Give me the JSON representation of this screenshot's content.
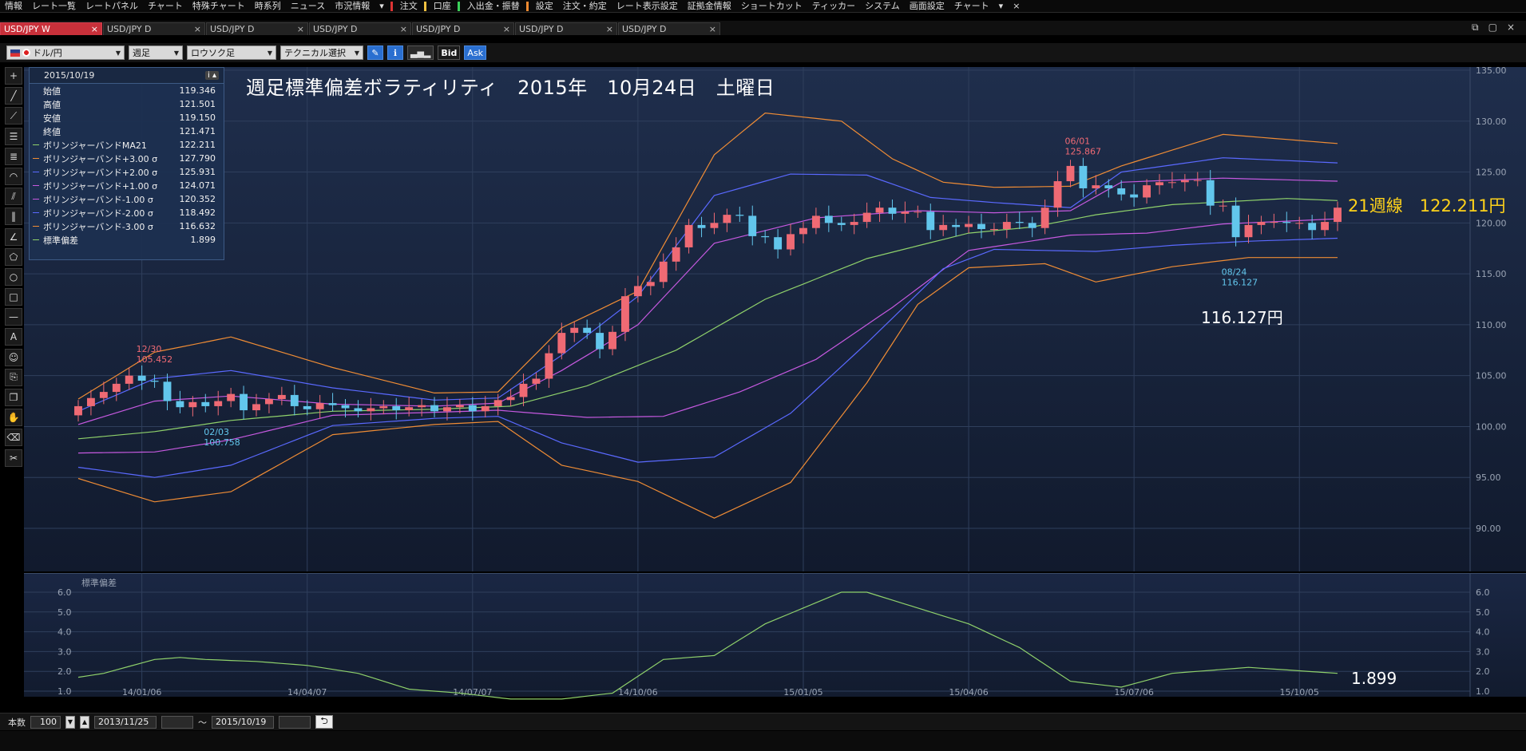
{
  "menu": {
    "items": [
      "情報",
      "レート一覧",
      "レートパネル",
      "チャート",
      "特殊チャート",
      "時系列",
      "ニュース",
      "市況情報",
      "▾",
      "注文",
      "口座",
      "入出金・振替",
      "設定",
      "注文・約定",
      "レート表示設定",
      "証拠金情報",
      "ショートカット",
      "ティッカー",
      "システム",
      "画面設定",
      "チャート",
      "▾",
      "×"
    ]
  },
  "tabs": [
    {
      "label": "USD/JPY W",
      "close": "×"
    },
    {
      "label": "USD/JPY D",
      "close": "×"
    },
    {
      "label": "USD/JPY D",
      "close": "×"
    },
    {
      "label": "USD/JPY D",
      "close": "×"
    },
    {
      "label": "USD/JPY D",
      "close": "×"
    },
    {
      "label": "USD/JPY D",
      "close": "×"
    },
    {
      "label": "USD/JPY D",
      "close": "×"
    }
  ],
  "window_controls": {
    "restore": "⧉",
    "maximize": "▢",
    "close": "×"
  },
  "toolbar": {
    "pair": "ドル/円",
    "period": "週足",
    "chart_type": "ロウソク足",
    "technical": "テクニカル選択",
    "bid": "Bid",
    "ask": "Ask"
  },
  "info_panel": {
    "date": "2015/10/19",
    "button": "i ▴",
    "rows": [
      {
        "label": "始値",
        "value": "119.346",
        "color": ""
      },
      {
        "label": "高値",
        "value": "121.501",
        "color": ""
      },
      {
        "label": "安値",
        "value": "119.150",
        "color": ""
      },
      {
        "label": "終値",
        "value": "121.471",
        "color": ""
      },
      {
        "label": "ボリンジャーバンドMA21",
        "value": "122.211",
        "color": "#8fd16b"
      },
      {
        "label": "ボリンジャーバンド+3.00 σ",
        "value": "127.790",
        "color": "#ef8c35"
      },
      {
        "label": "ボリンジャーバンド+2.00 σ",
        "value": "125.931",
        "color": "#5a69ff"
      },
      {
        "label": "ボリンジャーバンド+1.00 σ",
        "value": "124.071",
        "color": "#c659e0"
      },
      {
        "label": "ボリンジャーバンド-1.00 σ",
        "value": "120.352",
        "color": "#c659e0"
      },
      {
        "label": "ボリンジャーバンド-2.00 σ",
        "value": "118.492",
        "color": "#5a69ff"
      },
      {
        "label": "ボリンジャーバンド-3.00 σ",
        "value": "116.632",
        "color": "#ef8c35"
      },
      {
        "label": "標準偏差",
        "value": "1.899",
        "color": "#8fd16b"
      }
    ]
  },
  "title": "週足標準偏差ボラティリティ　2015年　10月24日　土曜日",
  "annotations": {
    "ma_label": "21週線　122.211円",
    "low_price": "116.127円",
    "sd_value": "1.899"
  },
  "subchart_label": "標準偏差",
  "bottom": {
    "count_label": "本数",
    "count": "100",
    "from": "2013/11/25",
    "tilde": "～",
    "to": "2015/10/19",
    "icon": "⮌"
  },
  "chart_data": [
    {
      "type": "candlestick",
      "series_name": "USD/JPY 週足",
      "ylim": [
        90,
        135
      ],
      "y_ticks": [
        "135.00",
        "130.00",
        "125.00",
        "120.00",
        "115.00",
        "110.00",
        "105.00",
        "100.00",
        "95.00",
        "90.00"
      ],
      "x_ticks": [
        "14/01/06",
        "14/04/07",
        "14/07/07",
        "14/10/06",
        "15/01/05",
        "15/04/06",
        "15/07/06",
        "15/10/05"
      ],
      "grid": true,
      "candles_start": "2013/11/25",
      "close": [
        102.0,
        102.8,
        103.4,
        104.2,
        105.0,
        104.5,
        104.4,
        102.5,
        101.9,
        102.4,
        102.0,
        102.5,
        103.2,
        101.6,
        102.2,
        102.7,
        103.1,
        102.0,
        101.7,
        102.3,
        102.1,
        101.8,
        101.5,
        101.8,
        102.0,
        101.6,
        101.9,
        102.1,
        101.5,
        101.9,
        102.1,
        101.5,
        102.0,
        102.6,
        102.9,
        104.2,
        104.7,
        107.2,
        109.2,
        109.7,
        109.2,
        107.6,
        109.3,
        112.8,
        113.8,
        114.2,
        116.2,
        117.6,
        119.8,
        119.5,
        120.0,
        120.8,
        120.7,
        118.7,
        118.6,
        117.4,
        118.9,
        119.5,
        120.7,
        120.0,
        119.8,
        120.1,
        121.0,
        121.5,
        120.9,
        121.1,
        121.1,
        119.3,
        119.8,
        119.6,
        119.9,
        119.4,
        119.4,
        120.1,
        120.0,
        119.5,
        121.5,
        124.1,
        125.6,
        123.4,
        123.7,
        123.4,
        122.8,
        122.5,
        123.7,
        124.0,
        124.0,
        124.2,
        124.2,
        121.7,
        121.7,
        118.6,
        119.8,
        120.1,
        120.1,
        120.0,
        120.0,
        119.3,
        120.1,
        121.5
      ],
      "annotations": [
        {
          "label": "12/30",
          "value": "105.452"
        },
        {
          "label": "02/03",
          "value": "100.758"
        },
        {
          "label": "06/01",
          "value": "125.867"
        },
        {
          "label": "08/24",
          "value": "116.127"
        }
      ],
      "bands": [
        {
          "name": "MA21",
          "color": "#8fd16b",
          "keys": [
            [
              0,
              98.8
            ],
            [
              6,
              99.5
            ],
            [
              12,
              100.6
            ],
            [
              20,
              101.5
            ],
            [
              28,
              101.7
            ],
            [
              34,
              102.0
            ],
            [
              40,
              104.0
            ],
            [
              47,
              107.5
            ],
            [
              54,
              112.5
            ],
            [
              62,
              116.5
            ],
            [
              70,
              119.0
            ],
            [
              75,
              119.6
            ],
            [
              80,
              120.8
            ],
            [
              86,
              121.8
            ],
            [
              95,
              122.4
            ],
            [
              99,
              122.2
            ]
          ]
        },
        {
          "name": "+1σ",
          "color": "#c659e0",
          "keys": [
            [
              0,
              100.2
            ],
            [
              6,
              102.5
            ],
            [
              12,
              103.0
            ],
            [
              20,
              102.2
            ],
            [
              28,
              102.0
            ],
            [
              33,
              102.3
            ],
            [
              38,
              105.5
            ],
            [
              44,
              110.0
            ],
            [
              50,
              118.0
            ],
            [
              58,
              120.5
            ],
            [
              66,
              121.2
            ],
            [
              72,
              121.0
            ],
            [
              78,
              121.2
            ],
            [
              82,
              124.0
            ],
            [
              90,
              124.4
            ],
            [
              99,
              124.1
            ]
          ]
        },
        {
          "name": "+2σ",
          "color": "#5a69ff",
          "keys": [
            [
              0,
              101.5
            ],
            [
              6,
              104.7
            ],
            [
              12,
              105.5
            ],
            [
              20,
              103.8
            ],
            [
              28,
              102.6
            ],
            [
              33,
              102.8
            ],
            [
              38,
              107.0
            ],
            [
              44,
              112.8
            ],
            [
              50,
              122.7
            ],
            [
              56,
              124.8
            ],
            [
              62,
              124.7
            ],
            [
              67,
              122.5
            ],
            [
              72,
              122.0
            ],
            [
              78,
              121.5
            ],
            [
              82,
              125.0
            ],
            [
              90,
              126.4
            ],
            [
              99,
              125.9
            ]
          ]
        },
        {
          "name": "+3σ",
          "color": "#ef8c35",
          "keys": [
            [
              0,
              102.7
            ],
            [
              6,
              107.3
            ],
            [
              12,
              108.8
            ],
            [
              20,
              105.8
            ],
            [
              28,
              103.3
            ],
            [
              33,
              103.4
            ],
            [
              38,
              109.7
            ],
            [
              44,
              113.3
            ],
            [
              50,
              126.7
            ],
            [
              54,
              130.8
            ],
            [
              60,
              130.0
            ],
            [
              64,
              126.3
            ],
            [
              68,
              124.0
            ],
            [
              72,
              123.5
            ],
            [
              78,
              123.6
            ],
            [
              82,
              125.6
            ],
            [
              90,
              128.7
            ],
            [
              99,
              127.8
            ]
          ]
        },
        {
          "name": "-1σ",
          "color": "#c659e0",
          "keys": [
            [
              0,
              97.4
            ],
            [
              6,
              97.5
            ],
            [
              12,
              98.7
            ],
            [
              20,
              101.1
            ],
            [
              28,
              101.4
            ],
            [
              33,
              101.6
            ],
            [
              40,
              100.9
            ],
            [
              46,
              101.0
            ],
            [
              52,
              103.4
            ],
            [
              58,
              106.6
            ],
            [
              64,
              111.7
            ],
            [
              70,
              117.3
            ],
            [
              78,
              118.8
            ],
            [
              84,
              119.0
            ],
            [
              90,
              119.9
            ],
            [
              99,
              120.4
            ]
          ]
        },
        {
          "name": "-2σ",
          "color": "#5a69ff",
          "keys": [
            [
              0,
              96.0
            ],
            [
              6,
              95.0
            ],
            [
              12,
              96.2
            ],
            [
              20,
              100.1
            ],
            [
              28,
              100.8
            ],
            [
              33,
              101.0
            ],
            [
              38,
              98.4
            ],
            [
              44,
              96.5
            ],
            [
              50,
              97.0
            ],
            [
              56,
              101.3
            ],
            [
              62,
              108.2
            ],
            [
              68,
              115.5
            ],
            [
              72,
              117.4
            ],
            [
              80,
              117.2
            ],
            [
              86,
              117.8
            ],
            [
              92,
              118.2
            ],
            [
              99,
              118.5
            ]
          ]
        },
        {
          "name": "-3σ",
          "color": "#ef8c35",
          "keys": [
            [
              0,
              94.9
            ],
            [
              6,
              92.6
            ],
            [
              12,
              93.6
            ],
            [
              20,
              99.2
            ],
            [
              28,
              100.2
            ],
            [
              33,
              100.5
            ],
            [
              38,
              96.2
            ],
            [
              44,
              94.6
            ],
            [
              50,
              91.0
            ],
            [
              56,
              94.5
            ],
            [
              62,
              104.3
            ],
            [
              66,
              112.0
            ],
            [
              70,
              115.6
            ],
            [
              76,
              116.0
            ],
            [
              80,
              114.2
            ],
            [
              86,
              115.7
            ],
            [
              92,
              116.6
            ],
            [
              99,
              116.6
            ]
          ]
        }
      ]
    },
    {
      "type": "line",
      "series": [
        {
          "name": "標準偏差",
          "color": "#8fd16b",
          "keys": [
            [
              0,
              1.7
            ],
            [
              2,
              1.9
            ],
            [
              6,
              2.6
            ],
            [
              8,
              2.7
            ],
            [
              10,
              2.6
            ],
            [
              14,
              2.5
            ],
            [
              18,
              2.3
            ],
            [
              22,
              1.9
            ],
            [
              26,
              1.1
            ],
            [
              30,
              0.9
            ],
            [
              34,
              0.6
            ],
            [
              38,
              0.6
            ],
            [
              42,
              0.9
            ],
            [
              46,
              2.6
            ],
            [
              50,
              2.8
            ],
            [
              54,
              4.4
            ],
            [
              60,
              6.0
            ],
            [
              62,
              6.0
            ],
            [
              66,
              5.2
            ],
            [
              70,
              4.4
            ],
            [
              74,
              3.2
            ],
            [
              78,
              1.5
            ],
            [
              82,
              1.2
            ],
            [
              86,
              1.9
            ],
            [
              92,
              2.2
            ],
            [
              99,
              1.9
            ]
          ]
        }
      ],
      "ylim": [
        0.5,
        6.5
      ],
      "y_ticks": [
        "6.0",
        "5.0",
        "4.0",
        "3.0",
        "2.0",
        "1.0"
      ]
    }
  ]
}
